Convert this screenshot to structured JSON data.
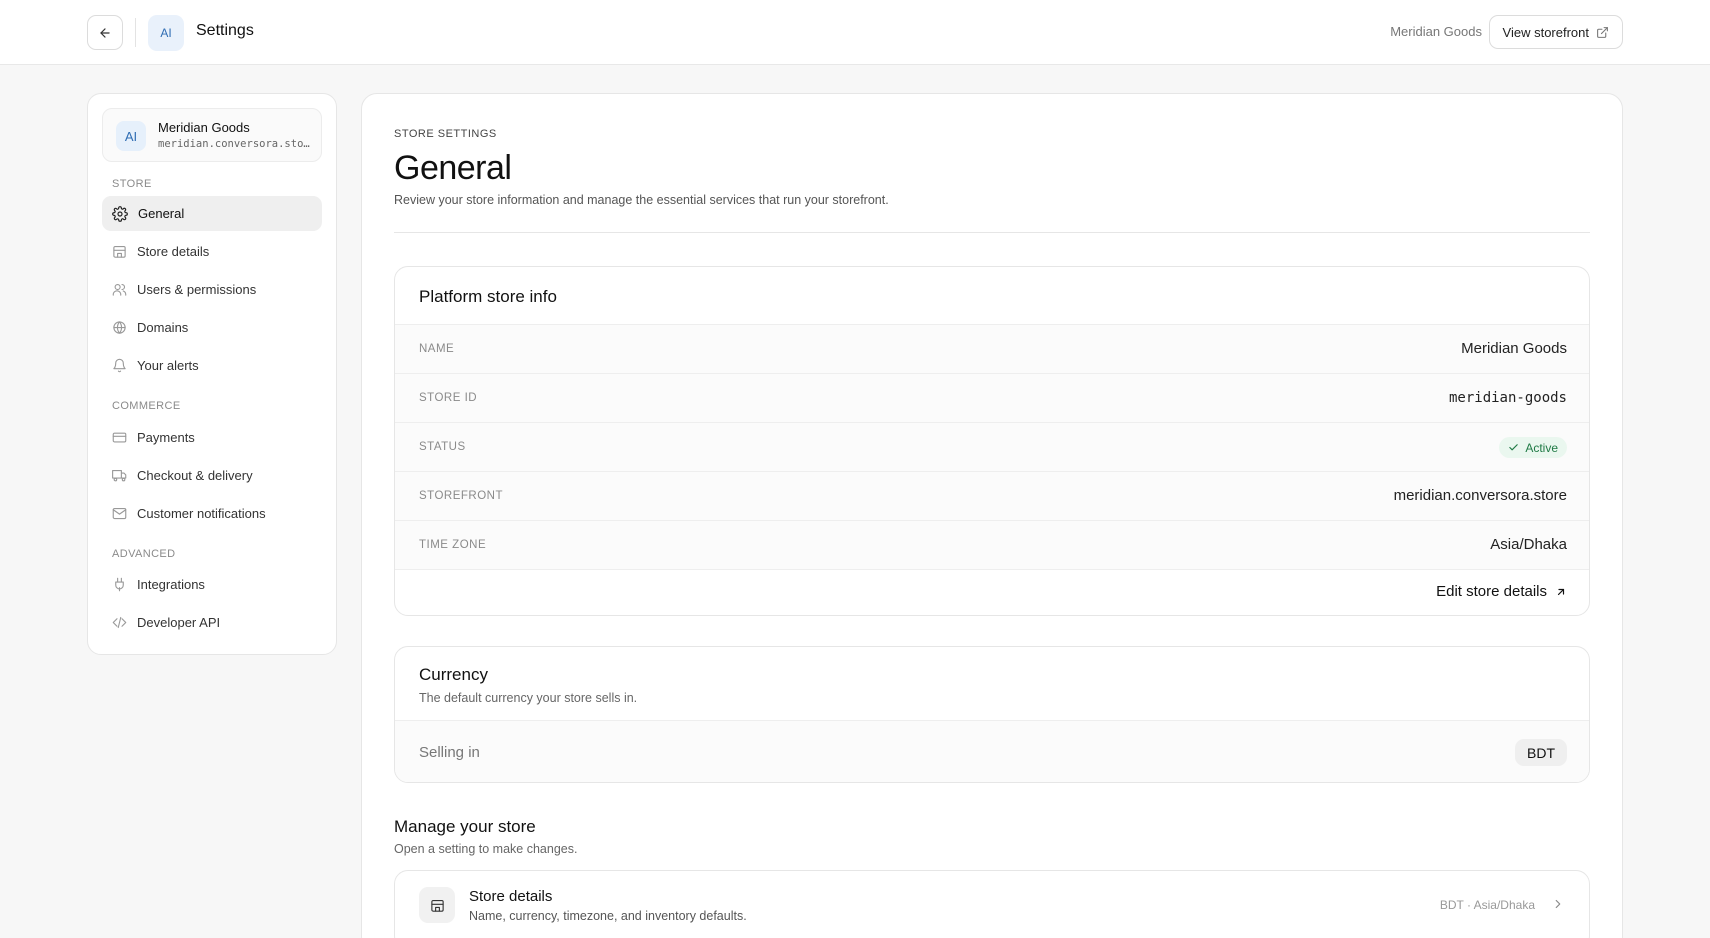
{
  "header": {
    "avatar_initials": "AI",
    "title": "Settings",
    "store_name": "Meridian Goods",
    "view_storefront_label": "View storefront"
  },
  "sidebar": {
    "store": {
      "initials": "AI",
      "name": "Meridian Goods",
      "domain": "meridian.conversora.store"
    },
    "sections": {
      "store": "STORE",
      "commerce": "COMMERCE",
      "advanced": "ADVANCED"
    },
    "items": {
      "general": "General",
      "store_details": "Store details",
      "users": "Users & permissions",
      "domains": "Domains",
      "alerts": "Your alerts",
      "payments": "Payments",
      "checkout": "Checkout & delivery",
      "notifications": "Customer notifications",
      "integrations": "Integrations",
      "developer": "Developer API"
    },
    "active_item": "General"
  },
  "main": {
    "eyebrow": "STORE SETTINGS",
    "title": "General",
    "subtitle": "Review your store information and manage the essential services that run your storefront.",
    "platform": {
      "title": "Platform store info",
      "rows": {
        "name": {
          "label": "NAME",
          "value": "Meridian Goods"
        },
        "store_id": {
          "label": "STORE ID",
          "value": "meridian-goods"
        },
        "status": {
          "label": "STATUS",
          "value": "Active"
        },
        "storefront": {
          "label": "STOREFRONT",
          "value": "meridian.conversora.store"
        },
        "timezone": {
          "label": "TIME ZONE",
          "value": "Asia/Dhaka"
        }
      },
      "edit_label": "Edit store details"
    },
    "currency": {
      "title": "Currency",
      "subtitle": "The default currency your store sells in.",
      "selling_label": "Selling in",
      "selling_value": "BDT"
    },
    "manage": {
      "title": "Manage your store",
      "subtitle": "Open a setting to make changes.",
      "items": [
        {
          "title": "Store details",
          "description": "Name, currency, timezone, and inventory defaults.",
          "meta": "BDT · Asia/Dhaka"
        }
      ]
    }
  },
  "colors": {
    "status_green": "#1f7a45",
    "status_bg": "#eaf7ef",
    "avatar_blue": "#2f6db3"
  }
}
